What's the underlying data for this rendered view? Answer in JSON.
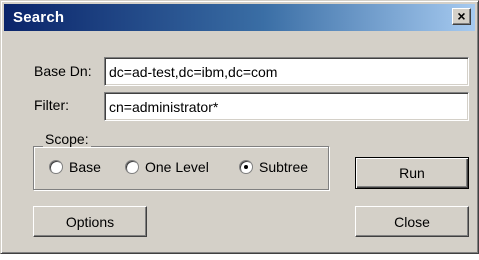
{
  "window": {
    "title": "Search",
    "close_glyph": "×"
  },
  "form": {
    "base_dn_label": "Base Dn:",
    "base_dn_value": "dc=ad-test,dc=ibm,dc=com",
    "filter_label": "Filter:",
    "filter_value": "cn=administrator*"
  },
  "scope": {
    "legend": "Scope:",
    "options": [
      {
        "label": "Base",
        "selected": false
      },
      {
        "label": "One Level",
        "selected": false
      },
      {
        "label": "Subtree",
        "selected": true
      }
    ]
  },
  "buttons": {
    "run": "Run",
    "options": "Options",
    "close": "Close"
  }
}
